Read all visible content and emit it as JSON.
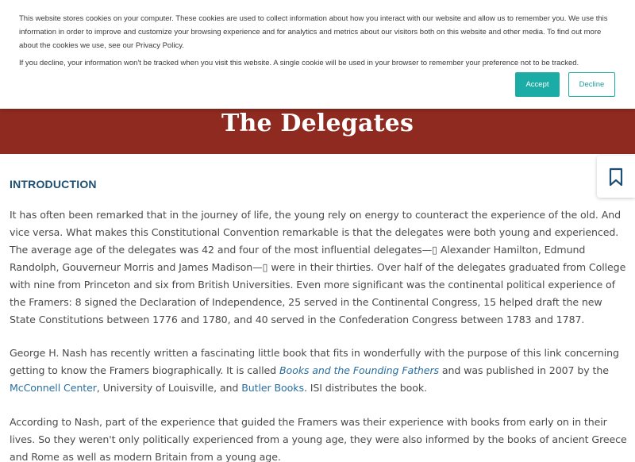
{
  "page": {
    "title": "The Delegates",
    "section_heading": "INTRODUCTION",
    "para1": "It has often been remarked that in the journey of life, the young rely on energy to counteract the experience of the old. And vice versa. What makes this Constitutional Convention remarkable is that the delegates were both young and experienced. The average age of the delegates was 42 and four of the most influential delegates—▯ Alexander Hamilton, Edmund Randolph, Gouverneur Morris and James Madison—▯ were in their thirties. Over half of the delegates graduated from College with nine from Princeton and six from British Universities. Even more significant was the continental political experience of the Framers: 8 signed the Declaration of Independence, 25 served in the Continental Congress, 15 helped draft the new State Constitutions between 1776 and 1780, and 40 served in the Confederation Congress between 1783 and 1787.",
    "para2": {
      "text_a": "George H. Nash has recently written a fascinating little book that fits in wonderfully with the purpose of this link concerning getting to know the Framers biographically. It is called ",
      "book_link": "Books and the Founding Fathers",
      "text_b": " and was published in 2007 by the ",
      "center_link": "McConnell Center",
      "text_c": ", University of Louisville, and ",
      "butler_link": "Butler Books",
      "text_d": ". ISI distributes the book."
    },
    "para3": "According to Nash, part of the experience that guided the Framers was their experience with books from early on in their lives. So they weren't only politically experienced from a young age, they were also informed by the books of ancient Greece and Rome as well as modern Britain from a young age."
  },
  "cookie_banner": {
    "text1": "This website stores cookies on your computer. These cookies are used to collect information about how you interact with our website and allow us to remember you. We use this information in order to improve and customize your browsing experience and for analytics and metrics about our visitors both on this website and other media. To find out more about the cookies we use, see our Privacy Policy.",
    "text2": "If you decline, your information won't be tracked when you visit this website. A single cookie will be used in your browser to remember your preference not to be tracked.",
    "accept_label": "Accept",
    "decline_label": "Decline"
  },
  "icons": {
    "bookmark": "bookmark-icon"
  },
  "colors": {
    "hero_bg": "#8e2a20",
    "heading": "#1e4f72",
    "link": "#2a6f9e",
    "accept_bg": "#1bada5"
  }
}
